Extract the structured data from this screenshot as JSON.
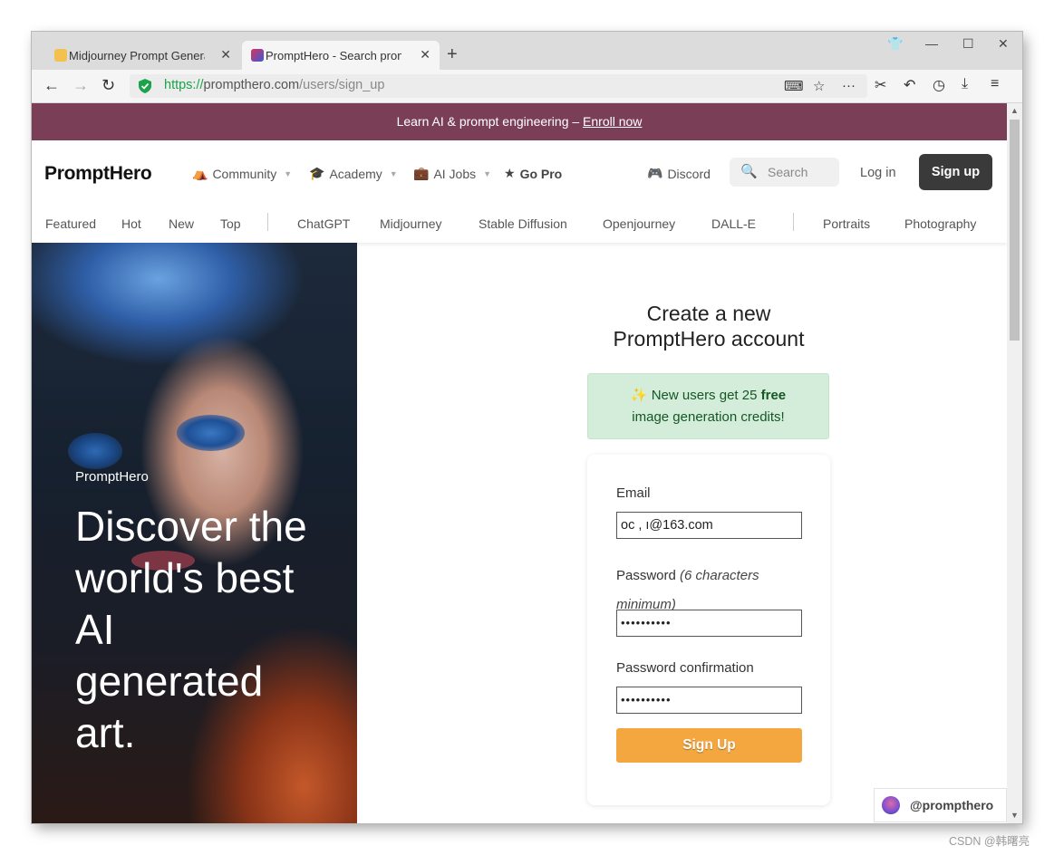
{
  "browser": {
    "tabs": [
      {
        "title": "Midjourney Prompt Genera",
        "active": false,
        "favicon_color": "#f2c14e"
      },
      {
        "title": "PromptHero - Search prom",
        "active": true,
        "favicon_color": "#d9335c"
      }
    ],
    "url": {
      "scheme": "https://",
      "host": "prompthero.com",
      "path": "/users/sign_up"
    }
  },
  "banner": {
    "text": "Learn AI & prompt engineering –",
    "link": "Enroll now"
  },
  "header": {
    "logo": "PromptHero",
    "nav": [
      {
        "label": "Community",
        "icon": "community-icon",
        "dropdown": true
      },
      {
        "label": "Academy",
        "icon": "graduation-cap-icon",
        "dropdown": true
      },
      {
        "label": "AI Jobs",
        "icon": "briefcase-icon",
        "dropdown": true
      },
      {
        "label": "Go Pro",
        "icon": "star-icon",
        "dropdown": false
      }
    ],
    "discord": "Discord",
    "search_placeholder": "Search",
    "login": "Log in",
    "signup": "Sign up",
    "categories": [
      "Featured",
      "Hot",
      "New",
      "Top",
      "ChatGPT",
      "Midjourney",
      "Stable Diffusion",
      "Openjourney",
      "DALL-E",
      "Portraits",
      "Photography"
    ]
  },
  "hero": {
    "brand": "PromptHero",
    "title": "Discover the world's best AI generated art."
  },
  "form": {
    "title_line1": "Create a new",
    "title_line2": "PromptHero account",
    "notice_icon": "✨",
    "notice_pre": "New users get 25",
    "notice_bold": "free",
    "notice_post": "image generation credits!",
    "email_label": "Email",
    "email_value": "oc    ,            ı@163.com",
    "password_label": "Password",
    "password_hint_line1": "(6 characters",
    "password_hint_line2": "minimum)",
    "password_value": "••••••••••",
    "confirm_label": "Password confirmation",
    "confirm_value": "••••••••••",
    "submit": "Sign Up"
  },
  "social_badge": "@prompthero",
  "watermark": "CSDN @韩曙亮",
  "colors": {
    "banner": "#7a3f57",
    "accent": "#f4a73e",
    "notice_bg": "#d4edda",
    "signup_bg": "#3a3a3a"
  }
}
